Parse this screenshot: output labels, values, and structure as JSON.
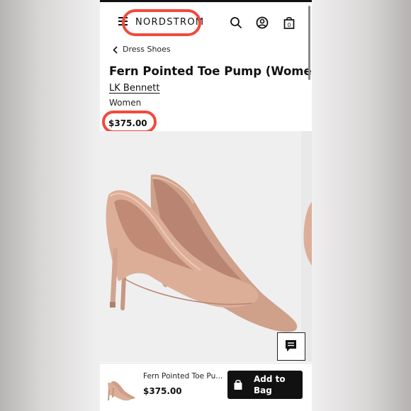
{
  "header": {
    "logo_text": "NORDSTROM",
    "icons": [
      "menu-icon",
      "search-icon",
      "account-icon",
      "bag-icon"
    ],
    "bag_count": "0"
  },
  "breadcrumb": {
    "label": "Dress Shoes"
  },
  "product": {
    "title": "Fern Pointed Toe Pump (Women)",
    "brand": "LK Bennett",
    "category": "Women",
    "price": "$375.00"
  },
  "bottom_bar": {
    "name": "Fern Pointed Toe Pu...",
    "price": "$375.00",
    "add_label": "Add to Bag"
  },
  "colors": {
    "annotation": "#f14a3d",
    "shoe": "#dcae98",
    "button": "#111111"
  }
}
